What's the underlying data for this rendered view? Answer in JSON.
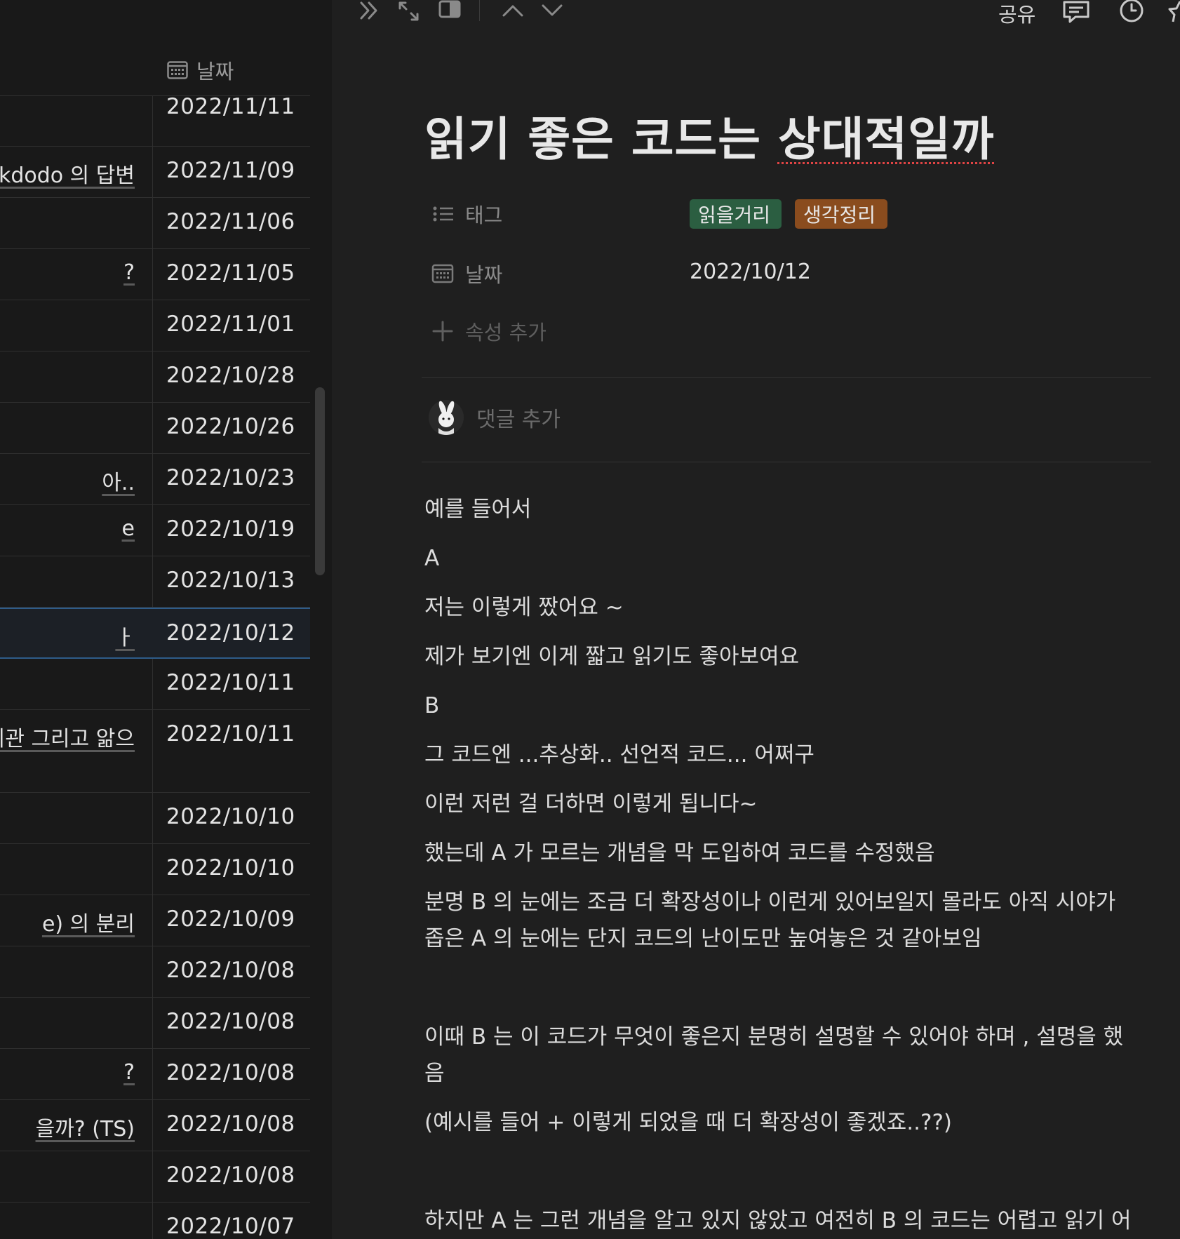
{
  "table": {
    "date_column_label": "날짜",
    "rows": [
      {
        "title": "",
        "date": "2022/11/11"
      },
      {
        "title": "kdodo 의 답변",
        "date": "2022/11/09"
      },
      {
        "title": "",
        "date": "2022/11/06"
      },
      {
        "title": "?",
        "date": "2022/11/05"
      },
      {
        "title": "",
        "date": "2022/11/01"
      },
      {
        "title": "",
        "date": "2022/10/28"
      },
      {
        "title": "",
        "date": "2022/10/26"
      },
      {
        "title": "아..",
        "date": "2022/10/23"
      },
      {
        "title": "e",
        "date": "2022/10/19"
      },
      {
        "title": "",
        "date": "2022/10/13"
      },
      {
        "title": "ㅏ",
        "date": "2022/10/12"
      },
      {
        "title": "",
        "date": "2022/10/11"
      },
      {
        "title": "리관 그리고 앎으",
        "date": "2022/10/11"
      },
      {
        "title": "",
        "date": "2022/10/10"
      },
      {
        "title": "",
        "date": "2022/10/10"
      },
      {
        "title": "e) 의 분리",
        "date": "2022/10/09"
      },
      {
        "title": "",
        "date": "2022/10/08"
      },
      {
        "title": "",
        "date": "2022/10/08"
      },
      {
        "title": "?",
        "date": "2022/10/08"
      },
      {
        "title": "을까? (TS)",
        "date": "2022/10/08"
      },
      {
        "title": "",
        "date": "2022/10/08"
      },
      {
        "title": "",
        "date": "2022/10/07"
      }
    ]
  },
  "topbar": {
    "share_label": "공유",
    "icons": [
      "collapse-icon",
      "expand-icon",
      "split-view-icon",
      "chevron-up-icon",
      "chevron-down-icon",
      "comments-icon",
      "history-icon",
      "favorite-icon"
    ]
  },
  "page": {
    "title_part1": "읽기 좋은 코드는 ",
    "title_part2": "상대적일까",
    "properties": {
      "tags_label": "태그",
      "tags": [
        "읽을거리",
        "생각정리"
      ],
      "date_label": "날짜",
      "date_value": "2022/10/12",
      "add_property_label": "속성 추가"
    },
    "comment_placeholder": "댓글 추가",
    "body": [
      "예를 들어서",
      "A",
      "저는 이렇게 짰어요 ~",
      "제가 보기엔 이게 짧고 읽기도 좋아보여요",
      "B",
      "그 코드엔 ...추상화.. 선언적 코드... 어쩌구",
      "이런 저런 걸 더하면  이렇게 됩니다~",
      "했는데 A 가 모르는 개념을 막 도입하여 코드를 수정했음",
      "분명 B 의 눈에는 조금 더 확장성이나 이런게 있어보일지 몰라도 아직 시야가",
      "좁은 A 의 눈에는 단지 코드의 난이도만 높여놓은 것 같아보임",
      "",
      "이때 B 는 이 코드가 무엇이 좋은지 분명히 설명할 수 있어야 하며 , 설명을 했",
      "음",
      "(예시를 들어 + 이렇게 되었을 때 더 확장성이 좋겠죠..??)",
      "",
      "하지만 A 는 그런 개념을 알고 있지 않았고 여전히 B 의 코드는 어렵고 읽기 어"
    ]
  },
  "colors": {
    "background": "#191919",
    "page_background": "#1f1f1f",
    "tag_green": "#2b5e41",
    "tag_orange": "#8a4c1e",
    "selected_row_border": "#2e5c8a"
  }
}
